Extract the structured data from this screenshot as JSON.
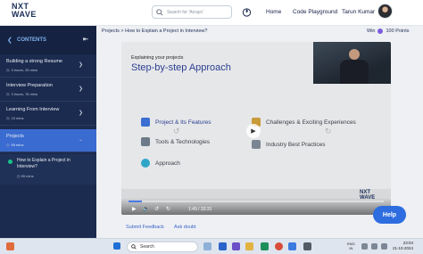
{
  "header": {
    "logo_line1": "NXT",
    "logo_line2": "WAVE",
    "logo_tm": "TM",
    "search_placeholder": "Search for 'Arrays'",
    "nav_home": "Home",
    "nav_code": "Code Playground",
    "user_name": "Tarun Kumar"
  },
  "sidebar": {
    "title": "CONTENTS",
    "modules": [
      {
        "title": "Building a strong Resume",
        "duration": "3 hours, 25 mins"
      },
      {
        "title": "Interview Preparation",
        "duration": "3 hours, 76 mins"
      },
      {
        "title": "Learning From Interview",
        "duration": "23 mins"
      },
      {
        "title": "Projects",
        "duration": "55 mins"
      }
    ],
    "sub_item": {
      "title": "How to Explain a Project in Interview?",
      "duration": "55 mins"
    }
  },
  "main": {
    "breadcrumb": "Projects > How to Explain a Project in Interview?",
    "points": {
      "win_label": "Win",
      "value": "100 Points"
    },
    "video": {
      "slide_subtitle": "Explaining your projects",
      "slide_title": "Step-by-step Approach",
      "items": [
        "Project & Its Features",
        "Tools & Technologies",
        "Approach",
        "Challenges & Exciting Experiences",
        "Industry Best Practices"
      ],
      "brand_line1": "NXT",
      "brand_line2": "WAVE",
      "time": "1:49 / 33:31",
      "progress": 0.054
    },
    "links": [
      "Submit Feedback",
      "Ask doubt"
    ],
    "help_label": "Help"
  },
  "taskbar": {
    "search_label": "Search",
    "lang": "ENG",
    "region": "IN",
    "time": "23:04",
    "date": "21-10-2024"
  },
  "colors": {
    "sidebar_bg": "#1b2b4f",
    "active_module": "#3a6bd0",
    "accent": "#2e6de0",
    "slide_title": "#2b3f91"
  }
}
